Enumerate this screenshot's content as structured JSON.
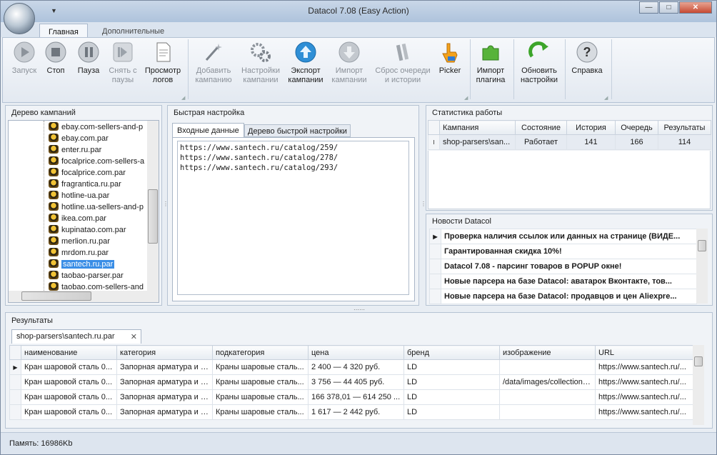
{
  "window": {
    "title": "Datacol 7.08 (Easy Action)",
    "min": "—",
    "max": "□",
    "close": "✕"
  },
  "ribbon_tabs": {
    "main": "Главная",
    "extra": "Дополнительные"
  },
  "ribbon": {
    "start": "Запуск",
    "stop": "Стоп",
    "pause": "Пауза",
    "unpause_1": "Снять с",
    "unpause_2": "паузы",
    "logs_1": "Просмотр",
    "logs_2": "логов",
    "add_1": "Добавить",
    "add_2": "кампанию",
    "settings_1": "Настройки",
    "settings_2": "кампании",
    "export_1": "Экспорт",
    "export_2": "кампании",
    "import_1": "Импорт",
    "import_2": "кампании",
    "reset_1": "Сброс очереди",
    "reset_2": "и истории",
    "picker": "Picker",
    "plugin_1": "Импорт",
    "plugin_2": "плагина",
    "update_1": "Обновить",
    "update_2": "настройки",
    "help": "Справка"
  },
  "tree": {
    "title": "Дерево кампаний",
    "items": [
      "ebay.com-sellers-and-p",
      "ebay.com.par",
      "enter.ru.par",
      "focalprice.com-sellers-a",
      "focalprice.com.par",
      "fragrantica.ru.par",
      "hotline-ua.par",
      "hotline.ua-sellers-and-p",
      "ikea.com.par",
      "kupinatao.com.par",
      "merlion.ru.par",
      "mrdom.ru.par",
      "santech.ru.par",
      "taobao-parser.par",
      "taobao.com-sellers-and"
    ],
    "selected": "santech.ru.par"
  },
  "quick": {
    "title": "Быстрая настройка",
    "tab_input": "Входные данные",
    "tab_tree": "Дерево быстрой настройки",
    "lines": [
      "https://www.santech.ru/catalog/259/",
      "https://www.santech.ru/catalog/278/",
      "https://www.santech.ru/catalog/293/"
    ]
  },
  "stats": {
    "title": "Статистика работы",
    "headers": [
      "Кампания",
      "Состояние",
      "История",
      "Очередь",
      "Результаты"
    ],
    "row": [
      "shop-parsers\\san...",
      "Работает",
      "141",
      "166",
      "114"
    ],
    "row_marker": "I"
  },
  "news": {
    "title": "Новости Datacol",
    "items": [
      "Проверка наличия ссылок или данных на странице (ВИДЕ...",
      "Гарантированная скидка 10%!",
      "Datacol 7.08 - парсинг товаров в POPUP окне!",
      "Новые парсера на базе Datacol: аватарок Вконтакте, тов...",
      "Новые парсера на базе Datacol: продавцов и цен Aliexpre..."
    ]
  },
  "results": {
    "title": "Результаты",
    "tab": "shop-parsers\\santech.ru.par",
    "tab_close": "✕",
    "headers": [
      "наименование",
      "категория",
      "подкатегория",
      "цена",
      "бренд",
      "изображение",
      "URL"
    ],
    "rows": [
      [
        "Кран шаровой сталь 0...",
        "Запорная арматура и з...",
        "Краны шаровые сталь...",
        "2 400 — 4 320 руб.",
        "LD",
        "",
        "https://www.santech.ru/..."
      ],
      [
        "Кран шаровой сталь 0...",
        "Запорная арматура и з...",
        "Краны шаровые сталь...",
        "3 756 — 44 405 руб.",
        "LD",
        "/data/images/collections...",
        "https://www.santech.ru/..."
      ],
      [
        "Кран шаровой сталь 0...",
        "Запорная арматура и з...",
        "Краны шаровые сталь...",
        "166 378,01 — 614 250 ...",
        "LD",
        "",
        "https://www.santech.ru/..."
      ],
      [
        "Кран шаровой сталь 0...",
        "Запорная арматура и з...",
        "Краны шаровые сталь...",
        "1 617 — 2 442 руб.",
        "LD",
        "",
        "https://www.santech.ru/..."
      ]
    ]
  },
  "status": {
    "memory": "Память: 16986Kb"
  }
}
